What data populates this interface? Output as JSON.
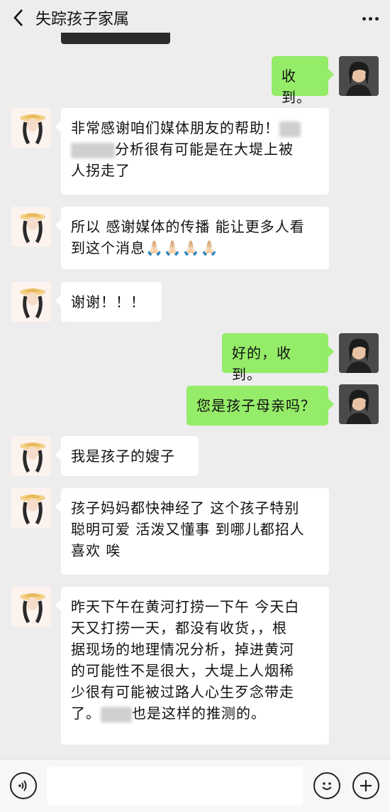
{
  "header": {
    "title": "失踪孩子家属",
    "back_icon": "chevron-left-icon",
    "more_icon": "more-dots-icon"
  },
  "messages": [
    {
      "side": "right",
      "text": "收到。"
    },
    {
      "side": "left",
      "line1_a": "非常感谢咱们媒体朋友的帮助！",
      "line2_b": "分析很有可能是在大堤上被",
      "line3": "人拐走了"
    },
    {
      "side": "left",
      "line1": "所以 感谢媒体的传播 能让更多人看",
      "line2": "到这个消息",
      "emoji": "🙏🏻🙏🏻🙏🏻🙏🏻"
    },
    {
      "side": "left",
      "text": "谢谢！！！"
    },
    {
      "side": "right",
      "text": "好的，收到。"
    },
    {
      "side": "right",
      "text": "您是孩子母亲吗？"
    },
    {
      "side": "left",
      "text": "我是孩子的嫂子"
    },
    {
      "side": "left",
      "line1": "孩子妈妈都快神经了 这个孩子特别",
      "line2": "聪明可爱 活泼又懂事 到哪儿都招人",
      "line3": "喜欢 唉"
    },
    {
      "side": "left",
      "line1": "昨天下午在黄河打捞一下午 今天白",
      "line2": "天又打捞一天，都没有收货，，根",
      "line3": "据现场的地理情况分析，掉进黄河",
      "line4": "的可能性不是很大，大堤上人烟稀",
      "line5": "少很有可能被过路人心生歹念带走",
      "line6_a": "了。",
      "line6_b": "也是这样的推测的。"
    }
  ],
  "footer": {
    "voice_icon": "voice-icon",
    "emoji_icon": "smiley-icon",
    "plus_icon": "plus-icon"
  },
  "colors": {
    "background": "#ededed",
    "sent_bubble": "#95ec69",
    "received_bubble": "#ffffff"
  }
}
